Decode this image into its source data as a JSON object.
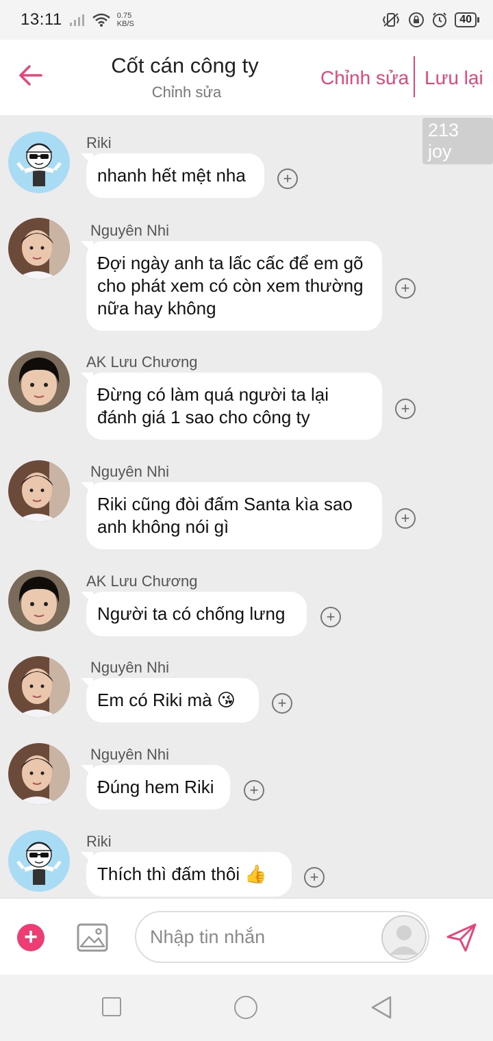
{
  "status_bar": {
    "time": "13:11",
    "speed_value": "0.75",
    "speed_unit": "KB/S",
    "battery": "40",
    "icons": [
      "signal-icon",
      "wifi-icon",
      "vibrate-icon",
      "lock-rotation-icon",
      "alarm-icon",
      "battery-icon"
    ]
  },
  "header": {
    "title": "Cốt cán công ty",
    "subtitle": "Chỉnh sửa",
    "edit_label": "Chỉnh sửa",
    "save_label": "Lưu lại"
  },
  "joy_badge": "213 joy",
  "messages": [
    {
      "sender": "Riki",
      "text": "nhanh hết mệt nha",
      "avatar": "cartoon"
    },
    {
      "sender": "Nguyên Nhi",
      "text": "Đợi ngày anh ta lấc cấc để em gõ cho phát xem có còn xem thường nữa hay không",
      "avatar": "boy-photo-a"
    },
    {
      "sender": "AK Lưu Chương",
      "text": "Đừng có làm quá người ta lại đánh giá 1 sao cho công ty",
      "avatar": "boy-photo-b"
    },
    {
      "sender": "Nguyên Nhi",
      "text": "Riki cũng đòi đấm Santa kìa sao anh không nói gì",
      "avatar": "boy-photo-a"
    },
    {
      "sender": "AK Lưu Chương",
      "text": "Người ta có chống lưng",
      "avatar": "boy-photo-b"
    },
    {
      "sender": "Nguyên Nhi",
      "text": "Em có Riki mà 😘",
      "avatar": "boy-photo-a"
    },
    {
      "sender": "Nguyên Nhi",
      "text": "Đúng hem Riki",
      "avatar": "boy-photo-a"
    },
    {
      "sender": "Riki",
      "text": "Thích thì đấm thôi 👍",
      "avatar": "cartoon"
    }
  ],
  "composer": {
    "placeholder": "Nhập tin nhắn",
    "value": ""
  },
  "colors": {
    "accent": "#e8457a",
    "chat_background": "#ececec",
    "bubble": "#ffffff"
  }
}
